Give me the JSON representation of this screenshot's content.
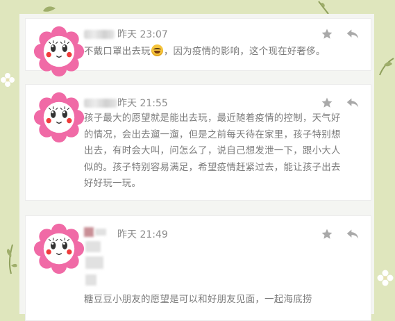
{
  "comments": [
    {
      "time": "昨天 23:07",
      "text_before_emoji": "不戴口罩出去玩",
      "emoji": "laugh-cry-emoji",
      "text_after_emoji": "，因为疫情的影响，这个现在好奢侈。"
    },
    {
      "time": "昨天 21:55",
      "text": "孩子最大的愿望就是能出去玩，最近随着疫情的控制，天气好的情况，会出去遛一遛，但是之前每天待在家里，孩子特别想出去，有时会大叫，问怎么了，说自己想发泄一下，跟小大人似的。孩子特别容易满足，希望疫情赶紧过去，能让孩子出去好好玩一玩。"
    },
    {
      "time": "昨天 21:49",
      "text": "糖豆豆小朋友的愿望是可以和好朋友见面，一起海底捞"
    }
  ],
  "colors": {
    "page_background": "#dfe6bd",
    "panel": "#f4f5f2",
    "card": "#ffffff",
    "timestamp": "#8c8c8c",
    "body_text": "#7b7b7b",
    "icon": "#a9a9a9",
    "avatar_petal": "#f06aa6"
  },
  "icons": {
    "favorite": "star-icon",
    "reply": "reply-arrow-icon",
    "avatar": "flower-face-avatar"
  }
}
